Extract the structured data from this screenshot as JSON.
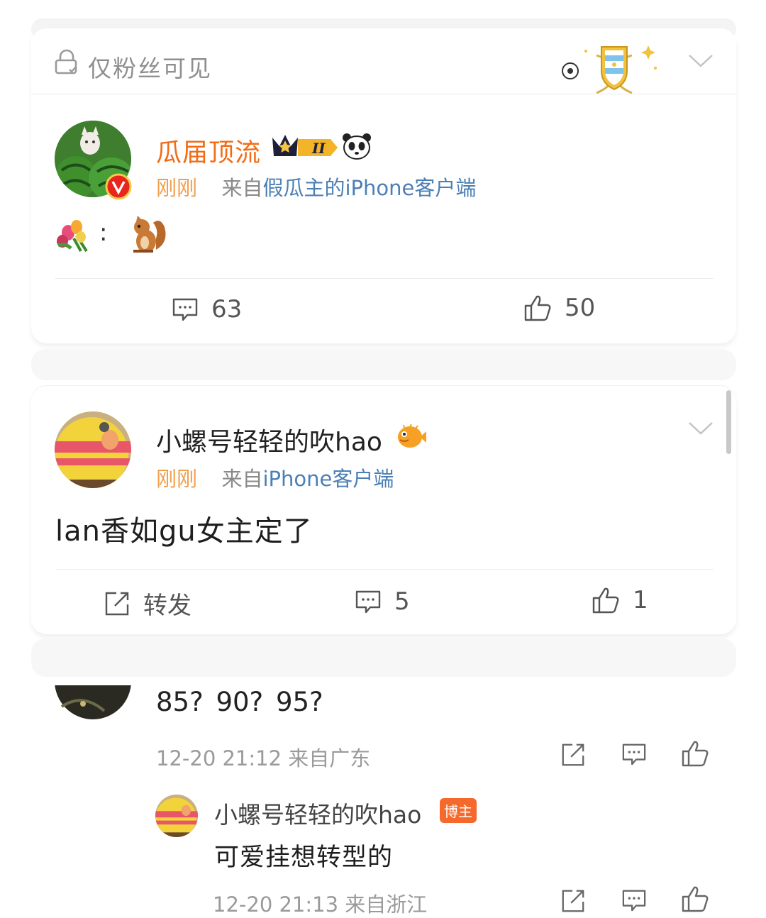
{
  "post1": {
    "visibility": "仅粉丝可见",
    "user": "瓜届顶流",
    "level_badge": "II",
    "time": "刚刚",
    "from_prefix": "来自",
    "source": "假瓜主的iPhone客户端",
    "content_separator": ":",
    "comments": "63",
    "likes": "50"
  },
  "post2": {
    "user": "小螺号轻轻的吹hao",
    "time": "刚刚",
    "from_prefix": "来自",
    "source": "iPhone客户端",
    "content": "lan香如gu女主定了",
    "repost_label": "转发",
    "comments": "5",
    "likes": "1"
  },
  "comment": {
    "text": "85? 90? 95?",
    "meta": "12-20 21:12 来自广东"
  },
  "reply": {
    "user": "小螺号轻轻的吹hao",
    "badge": "博主",
    "text": "可爱挂想转型的",
    "meta": "12-20 21:13 来自浙江"
  },
  "colors": {
    "username_orange": "#f26c16",
    "time_orange": "#f29e4c",
    "source_blue": "#4c7fb5",
    "badge_orange": "#f5692c",
    "verified_red": "#e8261c"
  }
}
